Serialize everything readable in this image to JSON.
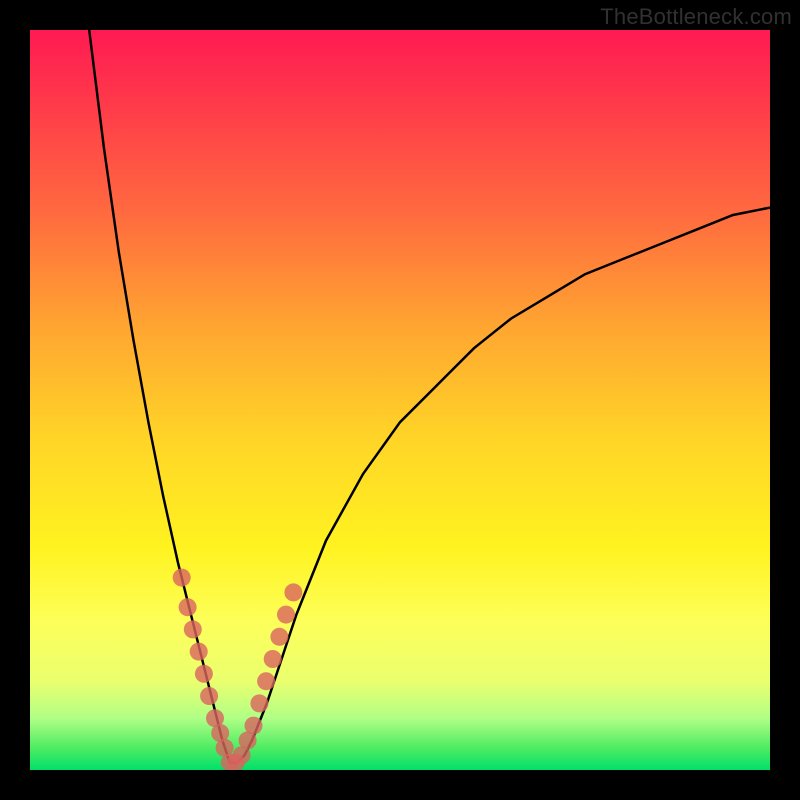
{
  "watermark": "TheBottleneck.com",
  "colors": {
    "frame": "#000000",
    "curve": "#000000",
    "dot": "#d9645f",
    "gradient_top": "#ff1a52",
    "gradient_bottom": "#00e06a"
  },
  "chart_data": {
    "type": "line",
    "title": "",
    "xlabel": "",
    "ylabel": "",
    "x_range": [
      0,
      100
    ],
    "y_range": [
      0,
      100
    ],
    "watermark": "TheBottleneck.com",
    "series": [
      {
        "name": "bottleneck-curve",
        "description": "V-shaped bottleneck curve; minimum near x≈27 at y≈0, rising steeply to y≈100 at x≈8 on the left and gradually to y≈76 at x=100 on the right",
        "x": [
          8,
          10,
          12,
          14,
          16,
          18,
          20,
          22,
          24,
          25,
          26,
          27,
          28,
          29,
          30,
          32,
          34,
          36,
          40,
          45,
          50,
          55,
          60,
          65,
          70,
          75,
          80,
          85,
          90,
          95,
          100
        ],
        "y": [
          100,
          84,
          70,
          58,
          47,
          37,
          28,
          20,
          12,
          8,
          4,
          1,
          1,
          2,
          4,
          9,
          15,
          21,
          31,
          40,
          47,
          52,
          57,
          61,
          64,
          67,
          69,
          71,
          73,
          75,
          76
        ]
      }
    ],
    "highlight_points": {
      "name": "pink-dots",
      "description": "Highlighted sample points clustered around the trough of the curve",
      "x": [
        20.5,
        21.3,
        22.0,
        22.8,
        23.5,
        24.2,
        25.0,
        25.7,
        26.3,
        27.0,
        27.8,
        28.6,
        29.4,
        30.2,
        31.0,
        31.9,
        32.8,
        33.7,
        34.6,
        35.6
      ],
      "y": [
        26,
        22,
        19,
        16,
        13,
        10,
        7,
        5,
        3,
        1,
        1,
        2,
        4,
        6,
        9,
        12,
        15,
        18,
        21,
        24
      ]
    }
  }
}
